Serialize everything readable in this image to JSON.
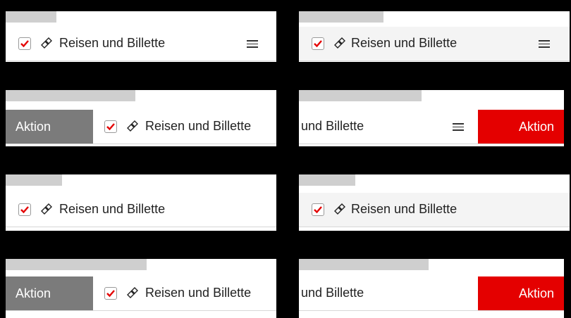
{
  "item": {
    "label": "Reisen und Billette",
    "checked": true,
    "icon": "tickets-icon"
  },
  "action": {
    "label": "Aktion"
  },
  "colors": {
    "accent": "#e40000",
    "action_gray": "#7b7b7b"
  }
}
